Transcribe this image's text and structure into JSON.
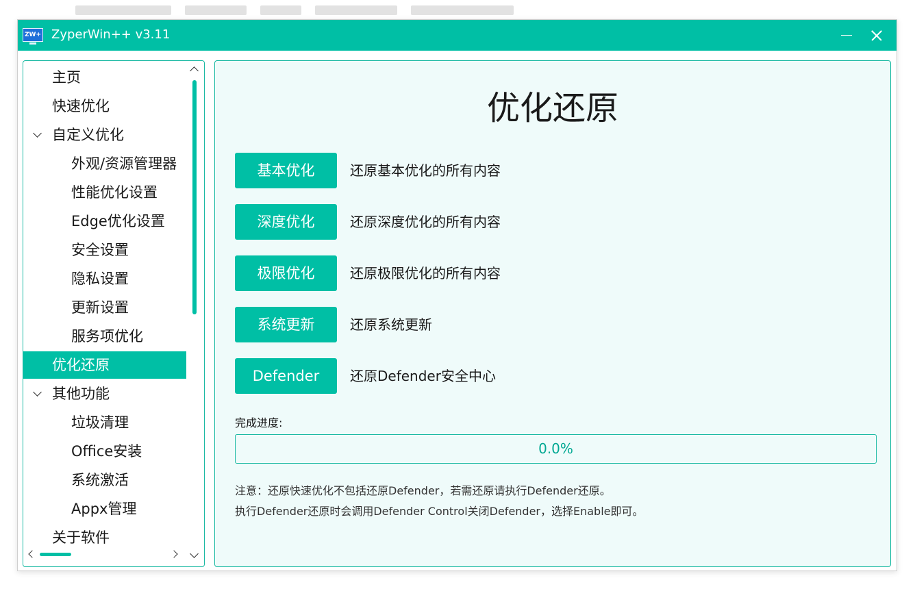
{
  "window": {
    "title": "ZyperWin++ v3.11",
    "icon_text": "ZW+",
    "accent_color": "#00bfa5",
    "minimize_icon": "minimize-icon",
    "close_icon": "close-icon"
  },
  "sidebar": {
    "items": [
      {
        "label": "主页"
      },
      {
        "label": "快速优化"
      },
      {
        "label": "自定义优化",
        "expanded": true
      },
      {
        "label": "外观/资源管理器"
      },
      {
        "label": "性能优化设置"
      },
      {
        "label": "Edge优化设置"
      },
      {
        "label": "安全设置"
      },
      {
        "label": "隐私设置"
      },
      {
        "label": "更新设置"
      },
      {
        "label": "服务项优化"
      },
      {
        "label": "优化还原",
        "selected": true
      },
      {
        "label": "其他功能",
        "expanded": true
      },
      {
        "label": "垃圾清理"
      },
      {
        "label": "Office安装"
      },
      {
        "label": "系统激活"
      },
      {
        "label": "Appx管理"
      },
      {
        "label": "关于软件"
      }
    ]
  },
  "main": {
    "title": "优化还原",
    "actions": [
      {
        "button": "基本优化",
        "description": "还原基本优化的所有内容"
      },
      {
        "button": "深度优化",
        "description": "还原深度优化的所有内容"
      },
      {
        "button": "极限优化",
        "description": "还原极限优化的所有内容"
      },
      {
        "button": "系统更新",
        "description": "还原系统更新"
      },
      {
        "button": "Defender",
        "description": "还原Defender安全中心"
      }
    ],
    "progress": {
      "label": "完成进度:",
      "value_text": "0.0%",
      "fraction": 0.0
    },
    "notes": [
      "注意：还原快速优化不包括还原Defender，若需还原请执行Defender还原。",
      "执行Defender还原时会调用Defender Control关闭Defender，选择Enable即可。"
    ]
  }
}
